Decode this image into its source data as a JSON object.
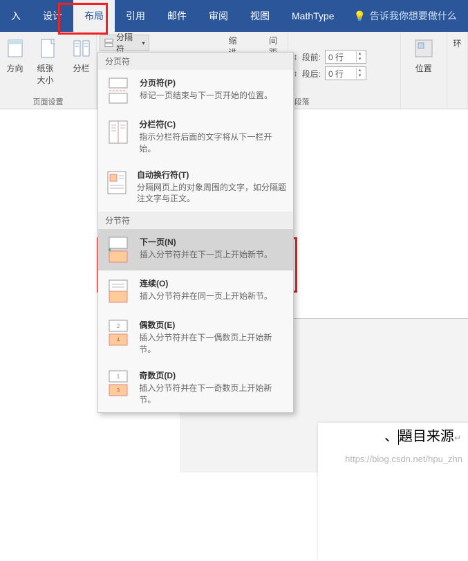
{
  "tabs": {
    "insert": "入",
    "design": "设计",
    "layout": "布局",
    "references": "引用",
    "mailings": "邮件",
    "review": "审阅",
    "view": "视图",
    "mathtype": "MathType",
    "tell_me": "告诉我你想要做什么"
  },
  "ribbon": {
    "orientation": "方向",
    "size": "纸张大小",
    "columns": "分栏",
    "breaks": "分隔符",
    "page_setup_label": "页面设置",
    "indent_label": "缩进",
    "spacing_label": "间距",
    "before_label": "段前:",
    "after_label": "段后:",
    "before_value": "0 行",
    "after_value": "0 行",
    "paragraph_label": "段落",
    "position": "位置",
    "wrap": "环"
  },
  "dropdown": {
    "page_breaks_header": "分页符",
    "section_breaks_header": "分节符",
    "items": [
      {
        "title": "分页符(P)",
        "desc": "标记一页结束与下一页开始的位置。"
      },
      {
        "title": "分栏符(C)",
        "desc": "指示分栏符后面的文字将从下一栏开始。"
      },
      {
        "title": "自动换行符(T)",
        "desc": "分隔网页上的对象周围的文字，如分隔题注文字与正文。"
      },
      {
        "title": "下一页(N)",
        "desc": "插入分节符并在下一页上开始新节。"
      },
      {
        "title": "连续(O)",
        "desc": "插入分节符并在同一页上开始新节。"
      },
      {
        "title": "偶数页(E)",
        "desc": "插入分节符并在下一偶数页上开始新节。"
      },
      {
        "title": "奇数页(D)",
        "desc": "插入分节符并在下一奇数页上开始新节。"
      }
    ]
  },
  "document": {
    "title_fragment": "、題目来源",
    "watermark": "https://blog.csdn.net/hpu_zhn"
  }
}
